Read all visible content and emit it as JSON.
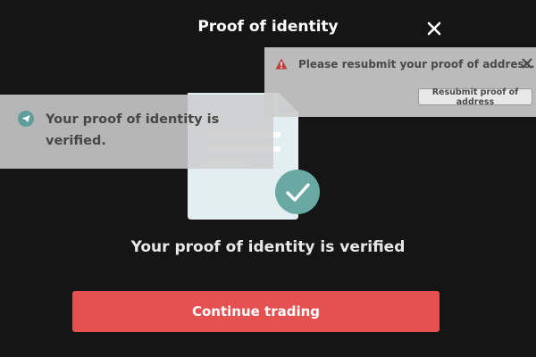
{
  "header": {
    "title": "Proof of identity",
    "close_icon": "close-icon"
  },
  "main": {
    "illustration": "document-check-illustration",
    "headline": "Your proof of identity is verified",
    "cta_label": "Continue trading"
  },
  "notifications": {
    "success": {
      "icon": "send-icon",
      "text": "Your proof of identity is verified."
    },
    "warning": {
      "icon": "warning-icon",
      "text": "Please resubmit your proof of address.",
      "action_label": "Resubmit proof of address",
      "dismiss_icon": "close-icon"
    }
  },
  "colors": {
    "background": "#151515",
    "accent": "#e55050",
    "check_teal": "#6aa8a4",
    "warning_red": "#c23b3b"
  }
}
